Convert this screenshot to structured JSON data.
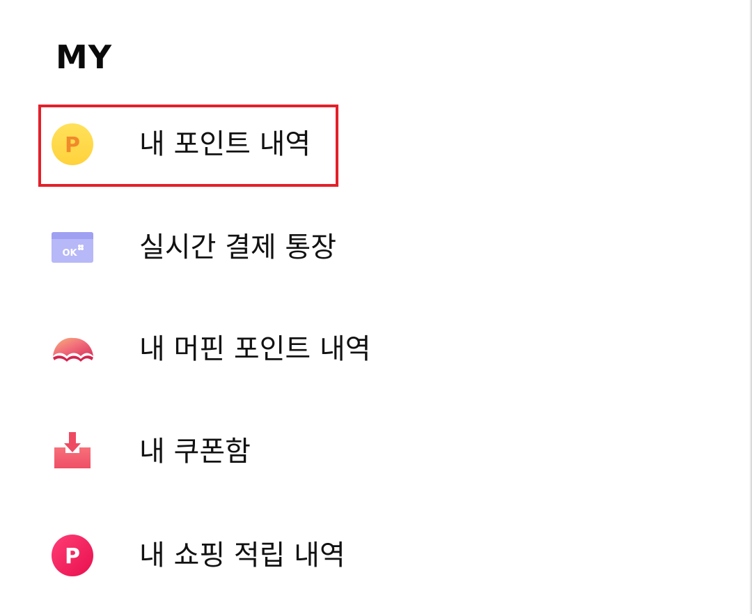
{
  "header": {
    "title": "MY"
  },
  "menu": {
    "items": [
      {
        "label": "내 포인트 내역",
        "icon": "point-coin-icon"
      },
      {
        "label": "실시간 결제 통장",
        "icon": "ok-card-icon"
      },
      {
        "label": "내 머핀 포인트 내역",
        "icon": "muffin-icon"
      },
      {
        "label": "내 쿠폰함",
        "icon": "coupon-download-icon"
      },
      {
        "label": "내 쇼핑 적립 내역",
        "icon": "shopping-point-icon"
      }
    ],
    "highlighted_index": 0
  },
  "colors": {
    "highlight_border": "#e3202a",
    "point_coin": "#ffd84a",
    "ok_card": "#a9a9f5",
    "muffin": "#f06a78",
    "coupon": "#f25a6a",
    "shopping_point": "#f0145a"
  },
  "icon_glyphs": {
    "point_coin": "P",
    "ok_card": "OK",
    "shopping_point": "P"
  }
}
